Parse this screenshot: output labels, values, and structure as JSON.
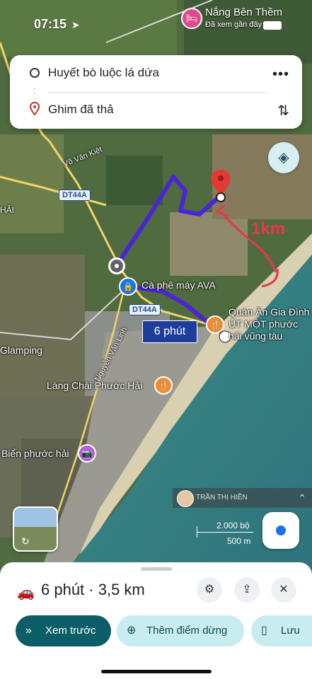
{
  "status": {
    "time": "07:15",
    "top_place_name": "Nắng Bên Thềm",
    "top_place_sub": "Đã xem gần đây"
  },
  "route_card": {
    "origin": "Huyết bò luộc lá dứa",
    "destination": "Ghim đã thả"
  },
  "map": {
    "roads": [
      "Võ Văn Kiệt",
      "DT44A",
      "DT44A",
      "Nguyễn Văn Linh"
    ],
    "places": [
      "Cà phê máy AVA",
      "Quán Ăn Gia Đình ÚT MỘT phước hải vũng tàu",
      "Làng Chài Phước Hải",
      "Biển phước hải",
      "Glamping",
      "HẢI"
    ],
    "eta_badge": "6 phút",
    "annotation": "1km",
    "route_color": "#4a24d6",
    "annotation_color": "#e8374d"
  },
  "attribution": {
    "name": "TRẦN THỊ HIỀN"
  },
  "scale": {
    "imperial": "2.000 bộ",
    "metric": "500 m"
  },
  "sheet": {
    "summary": "6 phút · 3,5 km",
    "preview_label": "Xem trước",
    "add_stop_label": "Thêm điểm dừng",
    "save_label": "Lưu"
  },
  "colors": {
    "primary_button": "#0b5e67",
    "secondary_button": "#c9ecf0",
    "locate_dot": "#1a73e8"
  }
}
